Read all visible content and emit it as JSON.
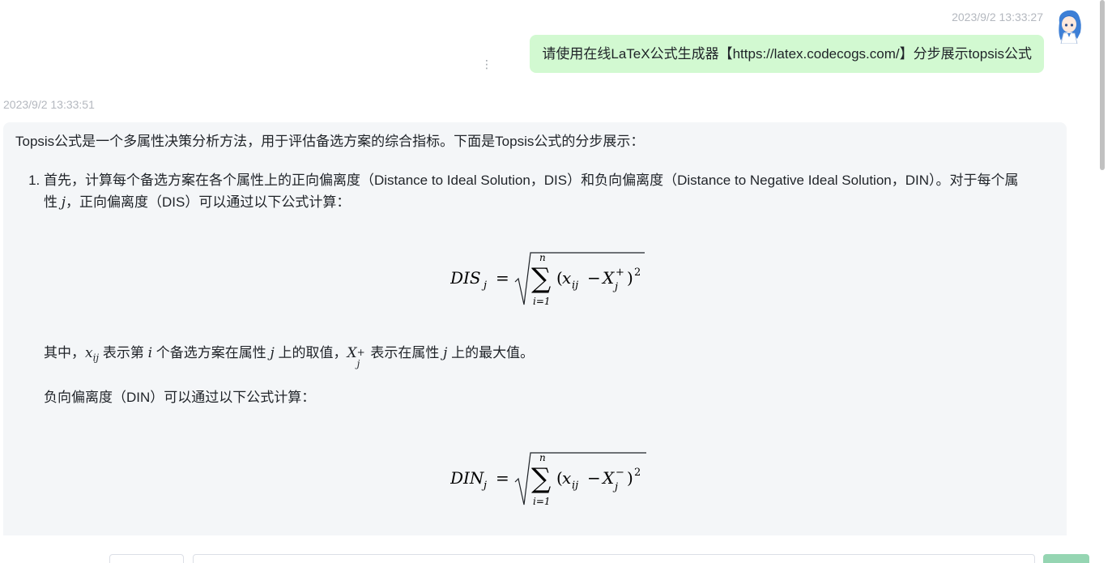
{
  "user_message": {
    "timestamp": "2023/9/2 13:33:27",
    "text": "请使用在线LaTeX公式生成器【https://latex.codecogs.com/】分步展示topsis公式"
  },
  "bot_message": {
    "timestamp": "2023/9/2 13:33:51",
    "intro": "Topsis公式是一个多属性决策分析方法，用于评估备选方案的综合指标。下面是Topsis公式的分步展示：",
    "step1_a": "首先，计算每个备选方案在各个属性上的正向偏离度（Distance to Ideal Solution，DIS）和负向偏离度（Distance to Negative Ideal Solution，DIN）。对于每个属",
    "step1_b_pre": "性 ",
    "step1_b_var": "j",
    "step1_b_post": "，正向偏离度（DIS）可以通过以下公式计算：",
    "formula1": {
      "lhs": "DIS",
      "sub": "j",
      "sum_top": "n",
      "sum_bottom": "i=1",
      "x": "x",
      "xsub": "ij",
      "X": "X",
      "Xsub": "j",
      "Xsup": "+",
      "power": "2"
    },
    "explain1": {
      "p1": "其中，",
      "x": "x",
      "xsub": "ij",
      "p2": " 表示第 ",
      "i": "i",
      "p3": " 个备选方案在属性 ",
      "j": "j",
      "p4": " 上的取值，",
      "X": "X",
      "Xsub": "j",
      "Xsup": "+",
      "p5": " 表示在属性 ",
      "j2": "j",
      "p6": " 上的最大值。"
    },
    "para_din": "负向偏离度（DIN）可以通过以下公式计算：",
    "formula2": {
      "lhs": "DIN",
      "sub": "j",
      "sum_top": "n",
      "sum_bottom": "i=1",
      "x": "x",
      "xsub": "ij",
      "X": "X",
      "Xsub": "j",
      "Xsup": "−",
      "power": "2"
    }
  },
  "icons": {
    "avatar": "anime-avatar",
    "menu": "more-vertical-icon"
  }
}
